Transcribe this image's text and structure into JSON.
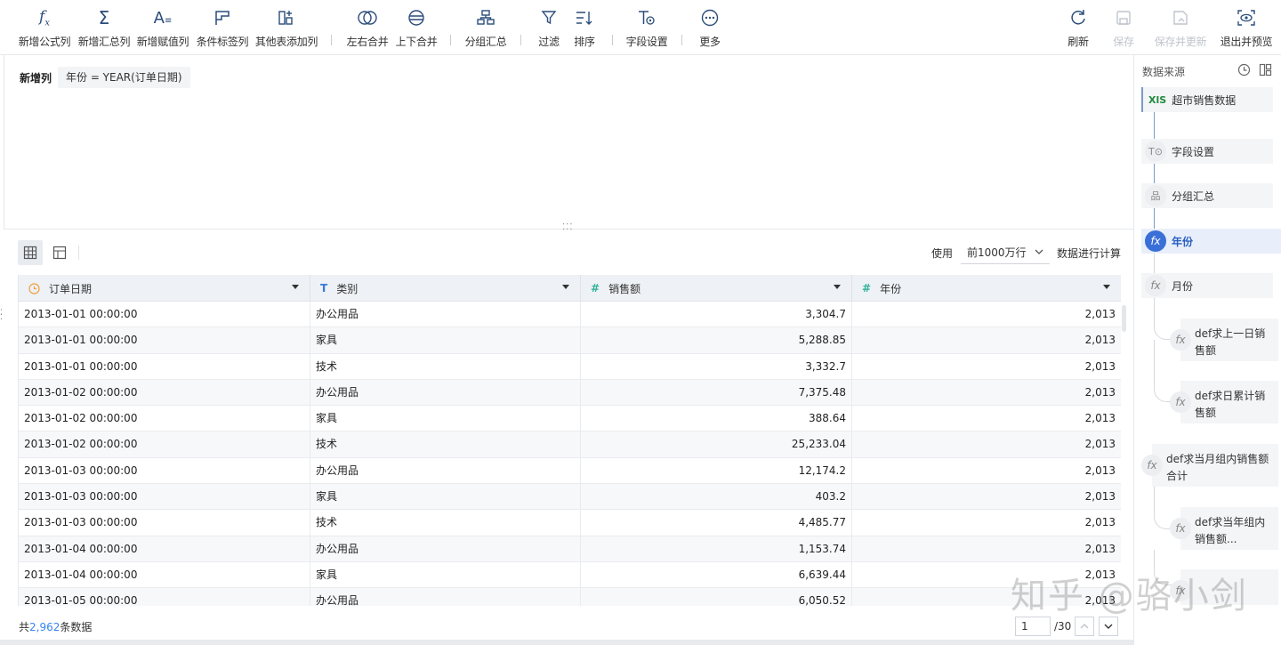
{
  "toolbar": {
    "items": [
      {
        "label": "新增公式列",
        "icon": "fx-icon"
      },
      {
        "label": "新增汇总列",
        "icon": "sigma-icon"
      },
      {
        "label": "新增赋值列",
        "icon": "assign-icon"
      },
      {
        "label": "条件标签列",
        "icon": "flag-icon"
      },
      {
        "label": "其他表添加列",
        "icon": "add-column-icon"
      },
      {
        "label": "左右合并",
        "icon": "merge-lr-icon"
      },
      {
        "label": "上下合并",
        "icon": "merge-ud-icon"
      },
      {
        "label": "分组汇总",
        "icon": "group-icon"
      },
      {
        "label": "过滤",
        "icon": "filter-icon"
      },
      {
        "label": "排序",
        "icon": "sort-icon"
      },
      {
        "label": "字段设置",
        "icon": "field-settings-icon"
      },
      {
        "label": "更多",
        "icon": "more-icon"
      }
    ],
    "right": [
      {
        "label": "刷新",
        "icon": "refresh-icon"
      },
      {
        "label": "保存",
        "icon": "save-icon"
      },
      {
        "label": "保存并更新",
        "icon": "save-update-icon"
      },
      {
        "label": "退出并预览",
        "icon": "preview-icon"
      }
    ]
  },
  "formula": {
    "label": "新增列",
    "expression": "年份 = YEAR(订单日期)"
  },
  "table_controls": {
    "use_label": "使用",
    "rows_option": "前1000万行",
    "calc_label": "数据进行计算"
  },
  "table": {
    "columns": [
      {
        "name": "订单日期",
        "type": "date"
      },
      {
        "name": "类别",
        "type": "text"
      },
      {
        "name": "销售额",
        "type": "number"
      },
      {
        "name": "年份",
        "type": "number"
      }
    ],
    "rows": [
      [
        "2013-01-01 00:00:00",
        "办公用品",
        "3,304.7",
        "2,013"
      ],
      [
        "2013-01-01 00:00:00",
        "家具",
        "5,288.85",
        "2,013"
      ],
      [
        "2013-01-01 00:00:00",
        "技术",
        "3,332.7",
        "2,013"
      ],
      [
        "2013-01-02 00:00:00",
        "办公用品",
        "7,375.48",
        "2,013"
      ],
      [
        "2013-01-02 00:00:00",
        "家具",
        "388.64",
        "2,013"
      ],
      [
        "2013-01-02 00:00:00",
        "技术",
        "25,233.04",
        "2,013"
      ],
      [
        "2013-01-03 00:00:00",
        "办公用品",
        "12,174.2",
        "2,013"
      ],
      [
        "2013-01-03 00:00:00",
        "家具",
        "403.2",
        "2,013"
      ],
      [
        "2013-01-03 00:00:00",
        "技术",
        "4,485.77",
        "2,013"
      ],
      [
        "2013-01-04 00:00:00",
        "办公用品",
        "1,153.74",
        "2,013"
      ],
      [
        "2013-01-04 00:00:00",
        "家具",
        "6,639.44",
        "2,013"
      ],
      [
        "2013-01-05 00:00:00",
        "办公用品",
        "6,050.52",
        "2,013"
      ]
    ]
  },
  "footer": {
    "total_prefix": "共",
    "total_count": "2,962",
    "total_suffix": "条数据",
    "page": "1",
    "page_total": "/30"
  },
  "panel": {
    "title": "数据来源",
    "source": "超市销售数据",
    "source_badge": "XlS",
    "steps": [
      "字段设置",
      "分组汇总",
      "年份",
      "月份"
    ],
    "active_step": "年份",
    "substeps": [
      "def求上一日销售额",
      "def求日累计销售额",
      "def求当月组内销售额合计",
      "def求当年组内销售额..."
    ]
  },
  "watermark": "知乎 @骆小剑"
}
